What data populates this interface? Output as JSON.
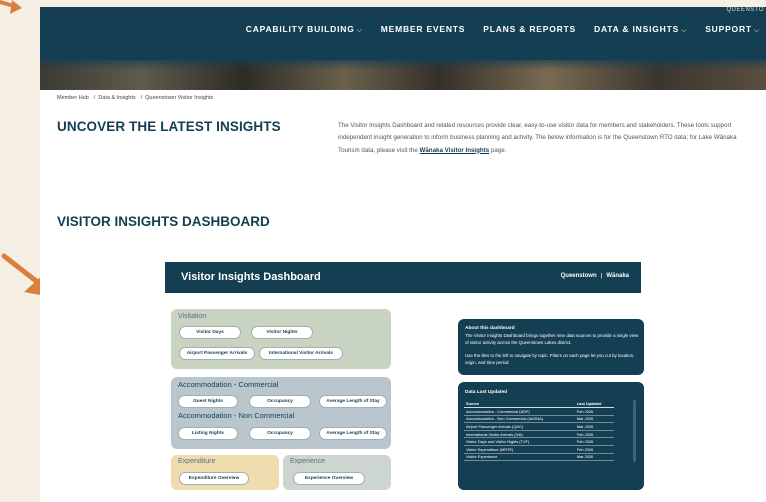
{
  "nav": {
    "items": [
      {
        "label": "CAPABILITY BUILDING",
        "dropdown": true
      },
      {
        "label": "MEMBER EVENTS",
        "dropdown": false
      },
      {
        "label": "PLANS & REPORTS",
        "dropdown": false
      },
      {
        "label": "DATA & INSIGHTS",
        "dropdown": true
      },
      {
        "label": "SUPPORT",
        "dropdown": true
      }
    ],
    "chevron": "⌵",
    "corner_text": "QUEENSTO"
  },
  "breadcrumb": [
    "Member Hub",
    "Data & Insights",
    "Queenstown Visitor Insights"
  ],
  "breadcrumb_sep": "/",
  "headings": {
    "uncover": "UNCOVER THE LATEST INSIGHTS",
    "visitor": "VISITOR INSIGHTS DASHBOARD"
  },
  "intro": {
    "text": "The Visitor Insights Dashboard and related resources provide clear, easy-to-use visitor data for members and stakeholders. These tools support independent insight generation to inform business planning and activity. The below information is for the Queenstown RTO data; for Lake Wānaka Tourism data, please visit the ",
    "link": "Wānaka Visitor Insights",
    "suffix": " page."
  },
  "dashboard": {
    "title": "Visitor Insights Dashboard",
    "logo_left": "Queenstown",
    "logo_sep": "|",
    "logo_right": "Wānaka",
    "visitation": {
      "title": "Visitation",
      "buttons": [
        "Visitor Days",
        "Visitor Nights",
        "Airport Passenger Arrivals",
        "International Visitor Arrivals"
      ]
    },
    "accom_commercial": {
      "title": "Accommodation - Commercial",
      "buttons": [
        "Guest Nights",
        "Occupancy",
        "Average Length of Stay"
      ]
    },
    "accom_noncommercial": {
      "title": "Accommodation - Non Commercial",
      "buttons": [
        "Listing Nights",
        "Occupancy",
        "Average Length of Stay"
      ]
    },
    "expenditure": {
      "title": "Expenditure",
      "button": "Expenditure Overview"
    },
    "experience": {
      "title": "Experience",
      "button": "Experience Overview"
    },
    "about": {
      "title": "About this dashboard",
      "text1": "The Visitor Insights Dashboard brings together nine data sources to provide a single view of visitor activity across the Queenstown Lakes district.",
      "text2": "Use the tiles to the left to navigate by topic. Filters on each page let you cut by location, origin, and time period."
    },
    "data_updated": {
      "title": "Data Last Updated",
      "headers": [
        "Source",
        "Last Updated"
      ],
      "rows": [
        [
          "Accommodation - Commercial (ADP)",
          "Feb 2026"
        ],
        [
          "Accommodation - Non Commercial (AirDNA)",
          "Mar 2026"
        ],
        [
          "Airport Passenger Arrivals (QAC)",
          "Mar 2026"
        ],
        [
          "International Visitor Arrivals (IVA)",
          "Feb 2026"
        ],
        [
          "Visitor Days and Visitor Nights (TVF)",
          "Feb 2026"
        ],
        [
          "Visitor Expenditure (MRTE)",
          "Feb 2026"
        ],
        [
          "Visitor Experience",
          "Mar 2026"
        ]
      ]
    }
  },
  "colors": {
    "navy": "#143e52",
    "visitation_tile": "#c8d3c2",
    "accommodation_tile": "#b9c6cd",
    "expenditure_tile": "#efdcae",
    "experience_tile": "#ccd5d0",
    "arrow": "#d97f3f",
    "background": "#f6efe3"
  }
}
